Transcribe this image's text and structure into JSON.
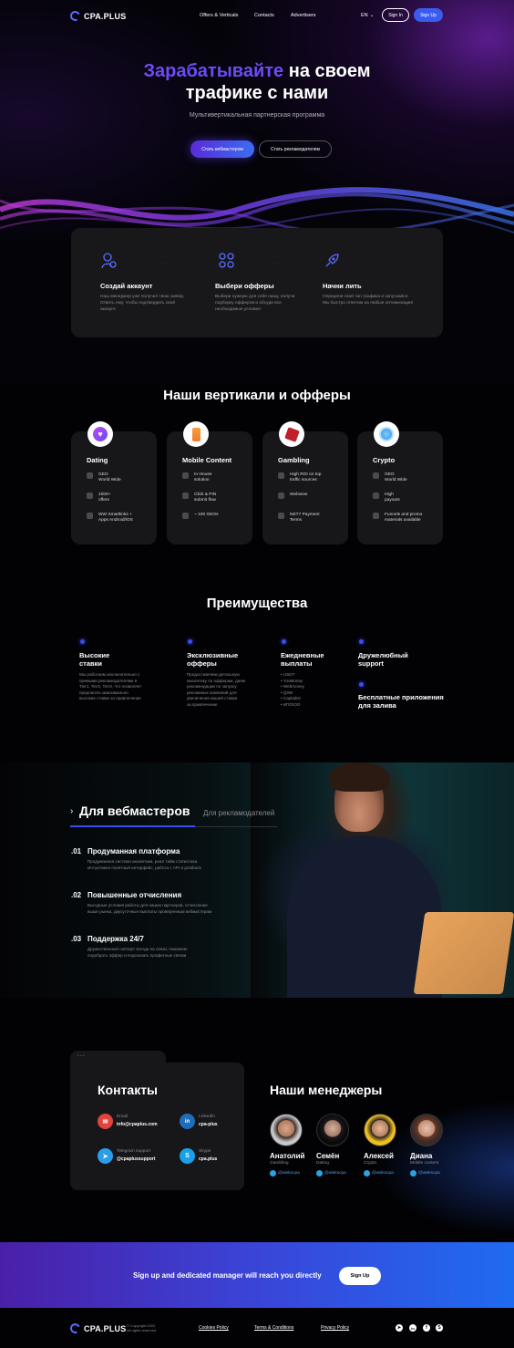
{
  "header": {
    "brand": "CPA.PLUS",
    "nav": [
      "Offers & Verticals",
      "Contacts",
      "Advertisers"
    ],
    "lang": "EN",
    "sign_in": "Sign In",
    "sign_up": "Sign Up"
  },
  "hero": {
    "title_accent": "Зарабатывайте",
    "title_rest_1": "на своем",
    "title_line2": "трафике с нами",
    "subtitle": "Мультивертикальная партнерская программа",
    "btn_webmaster": "Стать вебмастером",
    "btn_advertiser": "Стать рекламодателем"
  },
  "steps": [
    {
      "title": "Создай аккаунт",
      "desc": "Наш менеджер уже получил твою заявку. Ответь ему, чтобы подтвердить свой аккаунт.",
      "icon": "users-icon"
    },
    {
      "title": "Выбери офферы",
      "desc": "Выбери нужную для себя нишу, получи подборку офферов и обсуди все необходимые условия",
      "icon": "grid-icon"
    },
    {
      "title": "Начни лить",
      "desc": "Определи свой тип трафика и запускайся. Мы быстро ответим на любые оптимизации!",
      "icon": "rocket-icon"
    }
  ],
  "verticals": {
    "heading": "Наши вертикали и офферы",
    "items": [
      {
        "title": "Dating",
        "rows": [
          "GEO\nWorld Wide",
          "1000+\noffers",
          "WW Smartlinks +\nApps Android/iOS"
        ]
      },
      {
        "title": "Mobile Content",
        "rows": [
          "In-House\nsolution",
          "Click & PIN\nsubmit flow",
          "~ 100 GEOs"
        ]
      },
      {
        "title": "Gambling",
        "rows": [
          "High ROI on top\ntraffic sources",
          "Webview",
          "NET7 Payment\nTerms"
        ]
      },
      {
        "title": "Crypto",
        "rows": [
          "GEO\nWorld Wide",
          "High\npayouts",
          "Funnels and promo\nmaterials available"
        ]
      }
    ]
  },
  "advantages": {
    "heading": "Преимущества",
    "items": [
      {
        "title": "Высокие\nставки",
        "desc": "Мы работаем исключительно с\nпрямыми рекламодателями в\nTier1, Tier2, Tier3, что позволяет\nпредлагать максимально\nвысокие ставки за привлечение"
      },
      {
        "title": "Эксклюзивные\nофферы",
        "desc": "Предоставляем детальную\nаналитику по офферам, даем\nрекомендации по запуску\nрекламных компаний для\nувеличения вашей ставки\nза привлечение"
      },
      {
        "title": "Ежедневные\nвыплаты",
        "desc": "• USDT\n• YouMoney\n• Webmoney\n• QIWI\n• Capitalist\n• ИП/ООО"
      },
      {
        "title": "Дружелюбный\nsupport",
        "desc": ""
      },
      {
        "title": "Бесплатные приложения\nдля залива",
        "desc": ""
      }
    ]
  },
  "webmasters": {
    "tab_active": "Для вебмастеров",
    "tab_inactive": "Для рекламодателей",
    "features": [
      {
        "num": ".01",
        "title": "Продуманная платформа",
        "desc": "Продуманная система аналитики, реал тайм статистика.\nИнтуитивно понятный интерфейс, работа с API и postback"
      },
      {
        "num": ".02",
        "title": "Повышенные отчисления",
        "desc": "Выгодные условия работы для наших партнеров, отчисление\nвыше рынка, двусуточные выплаты проверенным вебмастерам"
      },
      {
        "num": ".03",
        "title": "Поддержка 24/7",
        "desc": "Дружественный саппорт всегда на связи, поможем\nподобрать оффер и подсказать профитные связки"
      }
    ]
  },
  "contacts": {
    "heading": "Контакты",
    "items": [
      {
        "label": "Email",
        "value": "info@cpaplus.com",
        "icon": "mail-icon",
        "color": "#e0443c"
      },
      {
        "label": "Linkedin",
        "value": "cpa-plus",
        "icon": "linkedin-icon",
        "color": "#1f6cb8"
      },
      {
        "label": "Telegram support",
        "value": "@cpaplussupport",
        "icon": "telegram-icon",
        "color": "#2a9ee8"
      },
      {
        "label": "Skype",
        "value": "cpa.plus",
        "icon": "skype-icon",
        "color": "#1aa0e8"
      }
    ]
  },
  "managers": {
    "heading": "Наши менеджеры",
    "items": [
      {
        "name": "Анатолий",
        "role": "Gambling",
        "handle": "@alekscpa"
      },
      {
        "name": "Семён",
        "role": "Dating",
        "handle": "@alekscpa"
      },
      {
        "name": "Алексей",
        "role": "Crypto",
        "handle": "@alekscpa"
      },
      {
        "name": "Диана",
        "role": "Mobile content",
        "handle": "@alekscpa"
      }
    ]
  },
  "cta": {
    "text": "Sign up and dedicated manager will reach you directly",
    "button": "Sign Up"
  },
  "footer": {
    "brand": "CPA.PLUS",
    "copyright": "© Copyright 2022\nAll rights reserved",
    "links": [
      "Cookies Policy",
      "Terms & Conditions",
      "Privacy Policy"
    ],
    "socials": [
      "telegram-icon",
      "linkedin-icon",
      "facebook-icon",
      "skype-icon"
    ]
  },
  "colors": {
    "accent": "#3b4cf0",
    "accent_purple": "#6d4cf5",
    "card": "#17171a"
  }
}
